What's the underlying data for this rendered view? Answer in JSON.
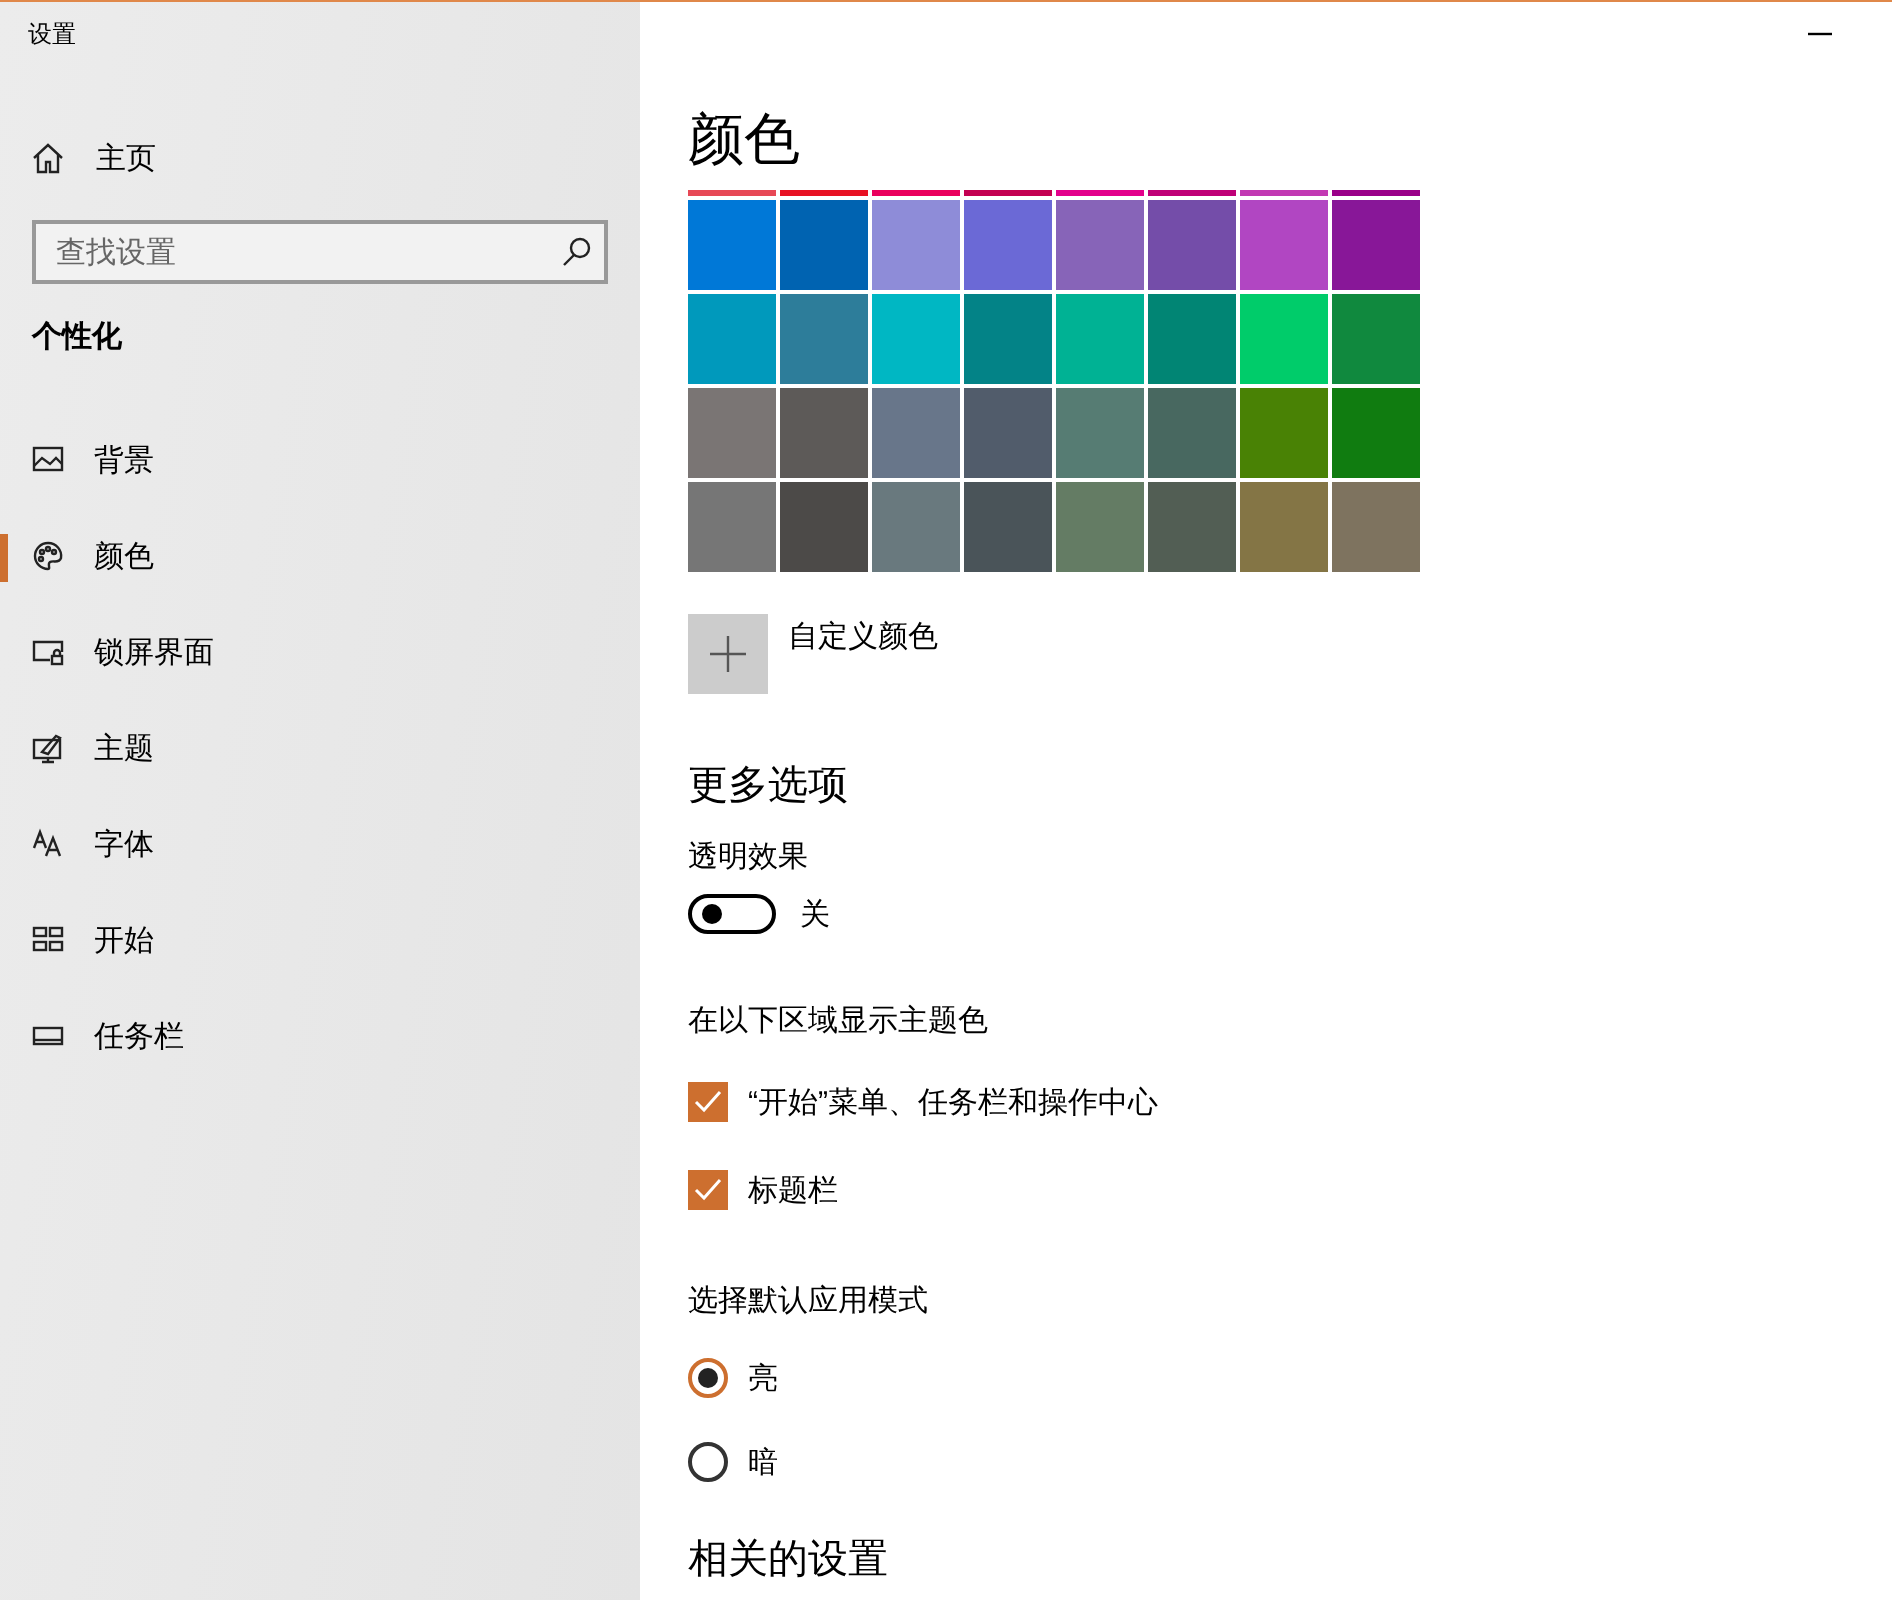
{
  "window": {
    "title": "设置"
  },
  "sidebar": {
    "home": "主页",
    "search": {
      "placeholder": "查找设置"
    },
    "section": "个性化",
    "items": [
      {
        "label": "背景",
        "selected": false
      },
      {
        "label": "颜色",
        "selected": true
      },
      {
        "label": "锁屏界面",
        "selected": false
      },
      {
        "label": "主题",
        "selected": false
      },
      {
        "label": "字体",
        "selected": false
      },
      {
        "label": "开始",
        "selected": false
      },
      {
        "label": "任务栏",
        "selected": false
      }
    ]
  },
  "content": {
    "title": "颜色",
    "swatch_rows": [
      {
        "partial": true,
        "swatches": [
          {
            "color": "#e74856"
          },
          {
            "color": "#e81123"
          },
          {
            "color": "#ea005e"
          },
          {
            "color": "#c30052"
          },
          {
            "color": "#e3008c"
          },
          {
            "color": "#bf0077"
          },
          {
            "color": "#c239b3"
          },
          {
            "color": "#9a0089"
          }
        ]
      },
      {
        "partial": false,
        "swatches": [
          {
            "color": "#0078d7"
          },
          {
            "color": "#0063b1"
          },
          {
            "color": "#8e8cd8"
          },
          {
            "color": "#6b69d6"
          },
          {
            "color": "#8764b8"
          },
          {
            "color": "#744da9"
          },
          {
            "color": "#b146c2"
          },
          {
            "color": "#881798"
          }
        ]
      },
      {
        "partial": false,
        "swatches": [
          {
            "color": "#0099bc"
          },
          {
            "color": "#2d7d9a"
          },
          {
            "color": "#00b7c3"
          },
          {
            "color": "#038387"
          },
          {
            "color": "#00b294"
          },
          {
            "color": "#018574"
          },
          {
            "color": "#00cc6a"
          },
          {
            "color": "#10893e"
          }
        ]
      },
      {
        "partial": false,
        "swatches": [
          {
            "color": "#7a7574"
          },
          {
            "color": "#5d5a58"
          },
          {
            "color": "#68768a"
          },
          {
            "color": "#515c6b"
          },
          {
            "color": "#567c73"
          },
          {
            "color": "#486860"
          },
          {
            "color": "#498205"
          },
          {
            "color": "#107c10"
          }
        ]
      },
      {
        "partial": false,
        "swatches": [
          {
            "color": "#767676"
          },
          {
            "color": "#4c4a48"
          },
          {
            "color": "#69797e"
          },
          {
            "color": "#4a5459"
          },
          {
            "color": "#647c64"
          },
          {
            "color": "#525e54"
          },
          {
            "color": "#847545"
          },
          {
            "color": "#7e735f"
          }
        ]
      }
    ],
    "custom_color": "自定义颜色",
    "more_options": {
      "heading": "更多选项",
      "transparency": {
        "label": "透明效果",
        "on": false,
        "state_text": "关"
      },
      "accent_heading": "在以下区域显示主题色",
      "checkboxes": [
        {
          "label": "“开始”菜单、任务栏和操作中心",
          "checked": true
        },
        {
          "label": "标题栏",
          "checked": true
        }
      ],
      "mode_heading": "选择默认应用模式",
      "modes": [
        {
          "label": "亮",
          "selected": true
        },
        {
          "label": "暗",
          "selected": false
        }
      ]
    },
    "related_heading": "相关的设置"
  }
}
